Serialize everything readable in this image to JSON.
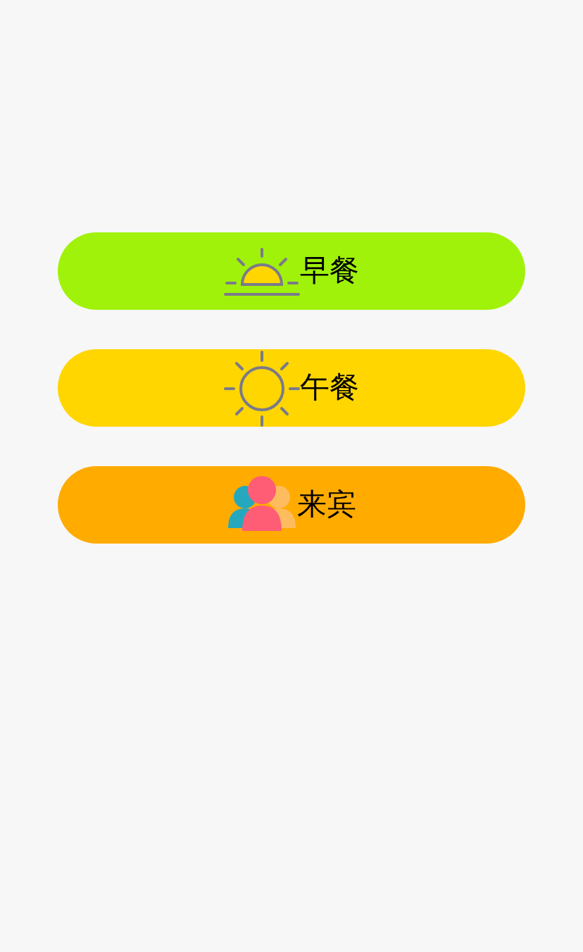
{
  "buttons": [
    {
      "label": "早餐",
      "kind": "sunrise",
      "color": "#a0f20a"
    },
    {
      "label": "午餐",
      "kind": "sun",
      "color": "#ffd600"
    },
    {
      "label": "来宾",
      "kind": "guests",
      "color": "#ffab00"
    }
  ]
}
